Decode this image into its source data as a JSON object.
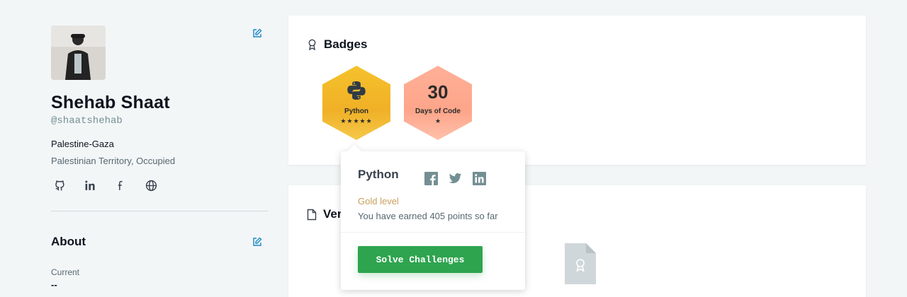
{
  "profile": {
    "name": "Shehab Shaat",
    "handle": "@shaatshehab",
    "location_city": "Palestine-Gaza",
    "location_country": "Palestinian Territory, Occupied",
    "socials": [
      "github-icon",
      "linkedin-icon",
      "facebook-icon",
      "website-globe-icon"
    ]
  },
  "about": {
    "title": "About",
    "current_label": "Current",
    "current_value": "--"
  },
  "badges_card": {
    "title": "Badges",
    "badges": [
      {
        "label": "Python",
        "stars": "★★★★★",
        "icon": "python-logo-icon",
        "color": "#f5c22b"
      },
      {
        "number": "30",
        "label": "Days of Code",
        "stars": "★",
        "color": "#ffb097"
      }
    ]
  },
  "verified_card": {
    "title": "Verified Skills"
  },
  "popover": {
    "title": "Python",
    "level": "Gold level",
    "points_text": "You have earned 405 points so far",
    "button_label": "Solve Challenges",
    "share": [
      "facebook-icon",
      "twitter-icon",
      "linkedin-icon"
    ]
  },
  "colors": {
    "accent": "#1b89c6",
    "button_green": "#2ea44f",
    "gold_text": "#c9a05e"
  }
}
